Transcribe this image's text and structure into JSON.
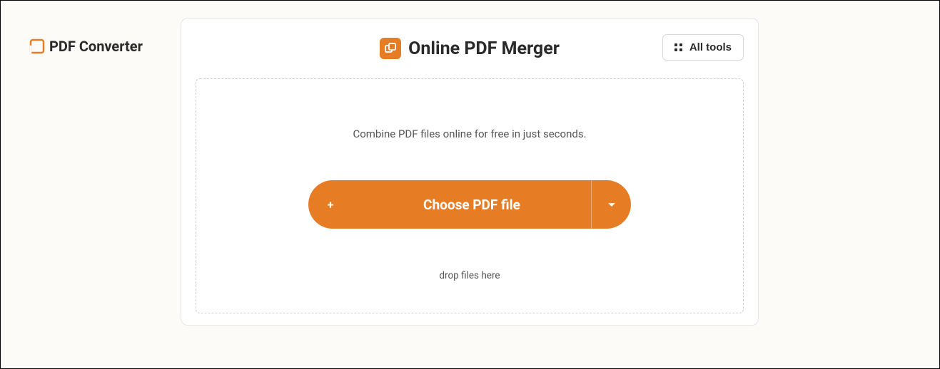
{
  "brand": {
    "name": "PDF Converter"
  },
  "card": {
    "title": "Online PDF Merger",
    "all_tools_label": "All tools",
    "subtitle": "Combine PDF files online for free in just seconds.",
    "choose_button_label": "Choose PDF file",
    "drop_hint": "drop files here"
  }
}
